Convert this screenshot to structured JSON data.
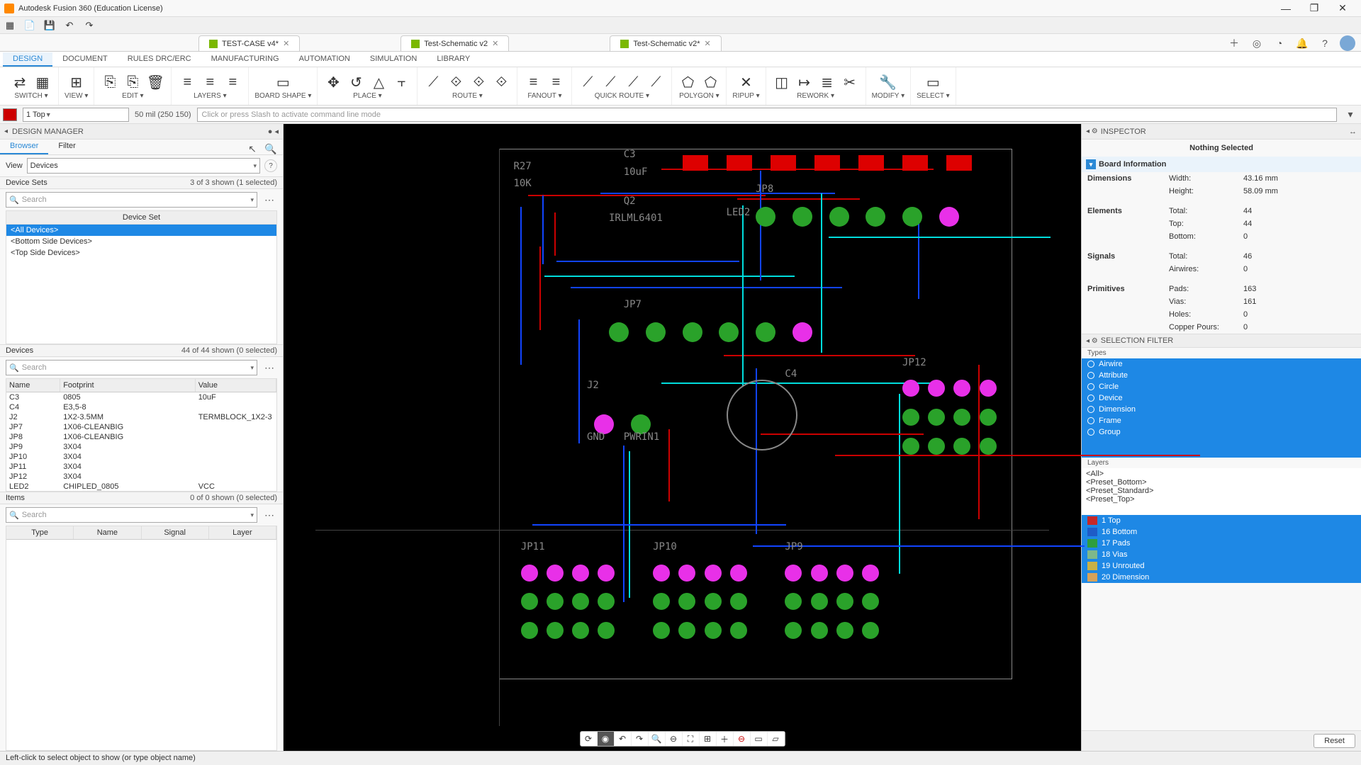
{
  "app": {
    "title": "Autodesk Fusion 360 (Education License)"
  },
  "file_tabs": [
    {
      "label": "TEST-CASE v4*"
    },
    {
      "label": "Test-Schematic v2"
    },
    {
      "label": "Test-Schematic v2*"
    }
  ],
  "workspace_tabs": {
    "active": "DESIGN",
    "items": [
      "DESIGN",
      "DOCUMENT",
      "RULES DRC/ERC",
      "MANUFACTURING",
      "AUTOMATION",
      "SIMULATION",
      "LIBRARY"
    ]
  },
  "ribbon": [
    {
      "label": "SWITCH",
      "icons": [
        "⇄",
        "▦"
      ]
    },
    {
      "label": "VIEW",
      "icons": [
        "⊞"
      ]
    },
    {
      "label": "EDIT",
      "icons": [
        "⎘",
        "⎘",
        "🗑"
      ]
    },
    {
      "label": "LAYERS",
      "icons": [
        "≡",
        "≡",
        "≡"
      ]
    },
    {
      "label": "BOARD SHAPE",
      "icons": [
        "▭"
      ]
    },
    {
      "label": "PLACE",
      "icons": [
        "✥",
        "↺",
        "△",
        "⫟"
      ]
    },
    {
      "label": "ROUTE",
      "icons": [
        "⟋",
        "⟐",
        "⟐",
        "⟐"
      ]
    },
    {
      "label": "FANOUT",
      "icons": [
        "≡",
        "≡"
      ]
    },
    {
      "label": "QUICK ROUTE",
      "icons": [
        "⟋",
        "⟋",
        "⟋",
        "⟋"
      ]
    },
    {
      "label": "POLYGON",
      "icons": [
        "⬠",
        "⬠"
      ]
    },
    {
      "label": "RIPUP",
      "icons": [
        "✕"
      ]
    },
    {
      "label": "REWORK",
      "icons": [
        "◫",
        "↦",
        "≣",
        "✂"
      ]
    },
    {
      "label": "MODIFY",
      "icons": [
        "🔧"
      ]
    },
    {
      "label": "SELECT",
      "icons": [
        "▭"
      ]
    }
  ],
  "topbar": {
    "layer": "1 Top",
    "coords": "50 mil (250 150)",
    "cmd_placeholder": "Click or press Slash to activate command line mode"
  },
  "design_manager": {
    "title": "DESIGN MANAGER",
    "tabs": [
      "Browser",
      "Filter"
    ],
    "view_label": "View",
    "view_value": "Devices",
    "device_sets": {
      "title": "Device Sets",
      "stat": "3 of 3 shown (1 selected)",
      "header": "Device Set",
      "items": [
        {
          "label": "<All Devices>",
          "selected": true
        },
        {
          "label": "<Bottom Side Devices>",
          "selected": false
        },
        {
          "label": "<Top Side Devices>",
          "selected": false
        }
      ]
    },
    "devices": {
      "title": "Devices",
      "stat": "44 of 44 shown (0 selected)",
      "columns": [
        "Name",
        "Footprint",
        "Value"
      ],
      "rows": [
        [
          "C3",
          "0805",
          "10uF"
        ],
        [
          "C4",
          "E3,5-8",
          ""
        ],
        [
          "J2",
          "1X2-3.5MM",
          "TERMBLOCK_1X2-3"
        ],
        [
          "JP7",
          "1X06-CLEANBIG",
          ""
        ],
        [
          "JP8",
          "1X06-CLEANBIG",
          ""
        ],
        [
          "JP9",
          "3X04",
          ""
        ],
        [
          "JP10",
          "3X04",
          ""
        ],
        [
          "JP11",
          "3X04",
          ""
        ],
        [
          "JP12",
          "3X04",
          ""
        ],
        [
          "LED2",
          "CHIPLED_0805",
          "VCC"
        ]
      ]
    },
    "items": {
      "title": "Items",
      "stat": "0 of 0 shown (0 selected)",
      "columns": [
        "Type",
        "Name",
        "Signal",
        "Layer"
      ]
    },
    "search_placeholder": "Search"
  },
  "status_text": "Left-click to select object to show (or type object name)",
  "inspector": {
    "title": "INSPECTOR",
    "nothing": "Nothing Selected",
    "board_info": "Board Information",
    "dimensions": {
      "label": "Dimensions",
      "width_l": "Width:",
      "width": "43.16 mm",
      "height_l": "Height:",
      "height": "58.09 mm"
    },
    "elements": {
      "label": "Elements",
      "total_l": "Total:",
      "total": "44",
      "top_l": "Top:",
      "top": "44",
      "bottom_l": "Bottom:",
      "bottom": "0"
    },
    "signals": {
      "label": "Signals",
      "total_l": "Total:",
      "total": "46",
      "airwires_l": "Airwires:",
      "airwires": "0"
    },
    "primitives": {
      "label": "Primitives",
      "pads_l": "Pads:",
      "pads": "163",
      "vias_l": "Vias:",
      "vias": "161",
      "holes_l": "Holes:",
      "holes": "0",
      "pours_l": "Copper Pours:",
      "pours": "0"
    }
  },
  "selection_filter": {
    "title": "SELECTION FILTER",
    "types_label": "Types",
    "types": [
      "Airwire",
      "Attribute",
      "Circle",
      "Device",
      "Dimension",
      "Frame",
      "Group"
    ],
    "layers_label": "Layers",
    "presets": [
      "<All>",
      "<Preset_Bottom>",
      "<Preset_Standard>",
      "<Preset_Top>"
    ],
    "layers": [
      {
        "color": "#c62828",
        "label": "1 Top"
      },
      {
        "color": "#1e5cc7",
        "label": "16 Bottom"
      },
      {
        "color": "#2e9e3f",
        "label": "17 Pads"
      },
      {
        "color": "#7fb88a",
        "label": "18 Vias"
      },
      {
        "color": "#c9b146",
        "label": "19 Unrouted"
      },
      {
        "color": "#d6a25b",
        "label": "20 Dimension"
      }
    ],
    "reset": "Reset"
  },
  "pcb_labels": {
    "R27": "R27",
    "10K": "10K",
    "C3": "C3",
    "10uF": "10uF",
    "Q2": "Q2",
    "IRLML6401": "IRLML6401",
    "LED2": "LED2",
    "JP8": "JP8",
    "JP7": "JP7",
    "J2": "J2",
    "JP12": "JP12",
    "JP11": "JP11",
    "JP10": "JP10",
    "JP9": "JP9",
    "PWRIN1": "PWRIN1",
    "GND": "GND",
    "C4": "C4"
  }
}
